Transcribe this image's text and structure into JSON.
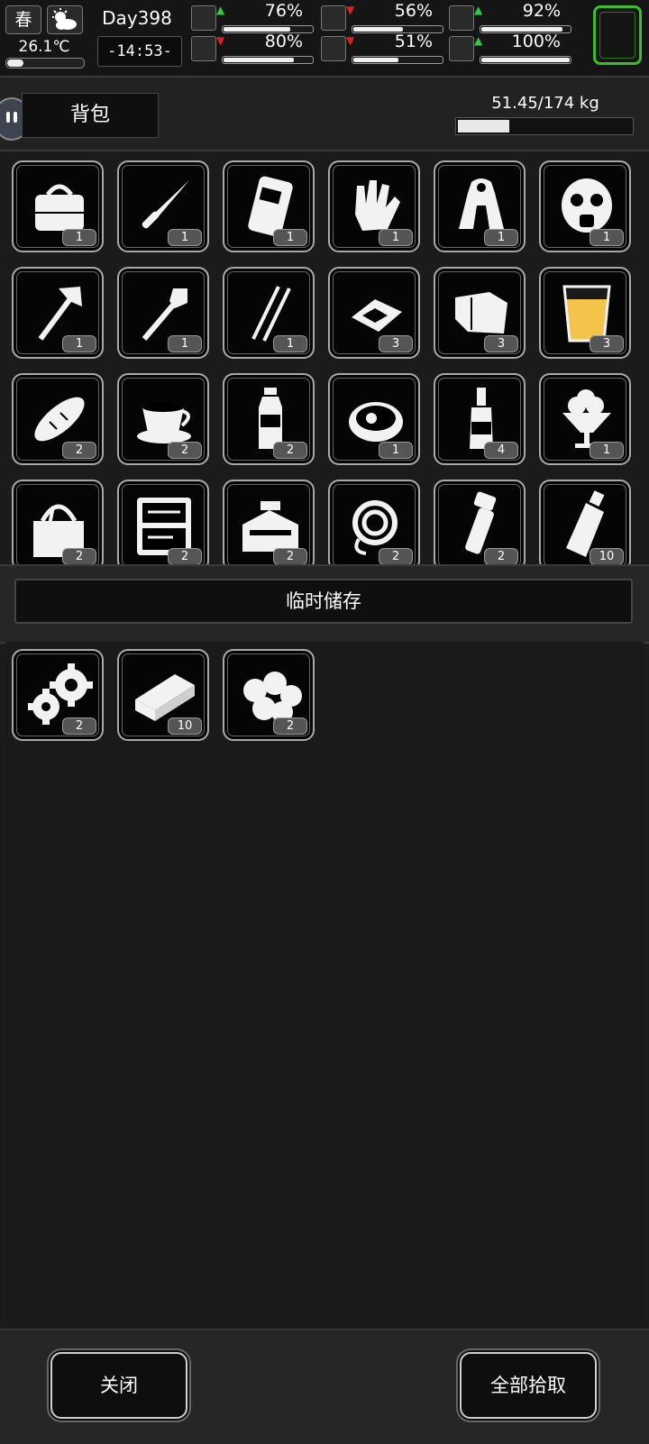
{
  "status": {
    "season": "春",
    "weather_icon": "partly-cloudy-icon",
    "temperature": "26.1℃",
    "day": "Day398",
    "time": "-14:53-",
    "stats": [
      {
        "icon": "medkit-icon",
        "trend": "up",
        "value": "76%",
        "level": 76
      },
      {
        "icon": "stomach-icon",
        "trend": "down",
        "value": "56%",
        "level": 56
      },
      {
        "icon": "pill-icon",
        "trend": "up",
        "value": "92%",
        "level": 92
      },
      {
        "icon": "leg-icon",
        "trend": "down",
        "value": "80%",
        "level": 80
      },
      {
        "icon": "water-drop-icon",
        "trend": "down",
        "value": "51%",
        "level": 51
      },
      {
        "icon": "heart-icon",
        "trend": "up",
        "value": "100%",
        "level": 100
      }
    ]
  },
  "backpack": {
    "tab_label": "背包",
    "weight": "51.45/174 kg",
    "weight_fraction": 0.296,
    "items": [
      {
        "name": "bag-icon",
        "count": "1"
      },
      {
        "name": "knife-icon",
        "count": "1"
      },
      {
        "name": "pad-icon",
        "count": "1"
      },
      {
        "name": "gloves-icon",
        "count": "1"
      },
      {
        "name": "raincoat-icon",
        "count": "1"
      },
      {
        "name": "gas-mask-icon",
        "count": "1"
      },
      {
        "name": "axe-icon",
        "count": "1"
      },
      {
        "name": "shovel-icon",
        "count": "1"
      },
      {
        "name": "hooks-icon",
        "count": "1"
      },
      {
        "name": "chips-icon",
        "count": "3"
      },
      {
        "name": "cloth-icon",
        "count": "3"
      },
      {
        "name": "juice-glass-icon",
        "count": "3"
      },
      {
        "name": "bread-icon",
        "count": "2"
      },
      {
        "name": "coffee-cup-icon",
        "count": "2"
      },
      {
        "name": "water-bottle-icon",
        "count": "2"
      },
      {
        "name": "stew-bowl-icon",
        "count": "1"
      },
      {
        "name": "liquor-bottle-icon",
        "count": "4"
      },
      {
        "name": "sundae-icon",
        "count": "1"
      },
      {
        "name": "tool-bag-icon",
        "count": "2"
      },
      {
        "name": "tool-case-icon",
        "count": "2"
      },
      {
        "name": "toolbox-icon",
        "count": "2"
      },
      {
        "name": "rope-icon",
        "count": "2"
      },
      {
        "name": "flashlight-icon",
        "count": "2"
      },
      {
        "name": "glass-bottle-icon",
        "count": "10"
      }
    ]
  },
  "temp_storage": {
    "title": "临时储存",
    "items": [
      {
        "name": "gears-icon",
        "count": "2"
      },
      {
        "name": "plank-icon",
        "count": "10"
      },
      {
        "name": "cotton-balls-icon",
        "count": "2"
      }
    ]
  },
  "buttons": {
    "close": "关闭",
    "pick_all": "全部拾取"
  }
}
